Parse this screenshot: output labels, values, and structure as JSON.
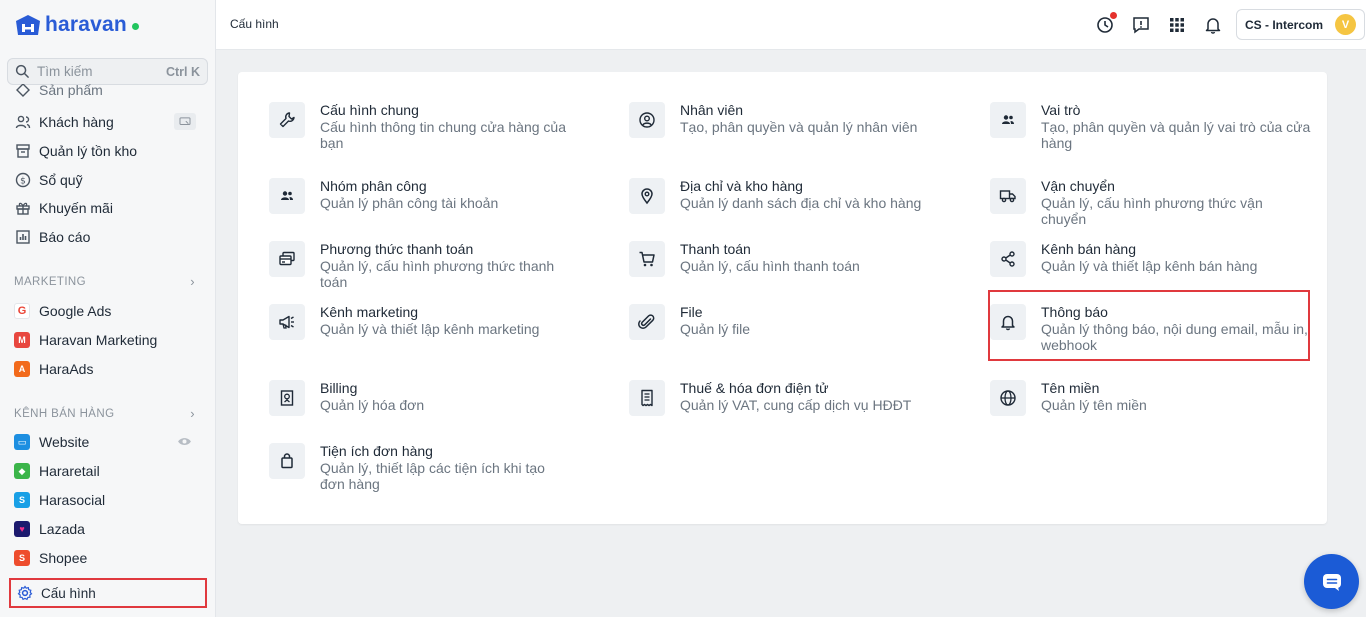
{
  "app": {
    "logo_text": "haravan"
  },
  "search": {
    "placeholder": "Tìm kiếm",
    "shortcut": "Ctrl K"
  },
  "sidebar": {
    "items": [
      {
        "label": "Sản phẩm"
      },
      {
        "label": "Khách hàng"
      },
      {
        "label": "Quản lý tồn kho"
      },
      {
        "label": "Sổ quỹ"
      },
      {
        "label": "Khuyến mãi"
      },
      {
        "label": "Báo cáo"
      }
    ],
    "marketing_section": "MARKETING",
    "marketing_items": [
      {
        "label": "Google Ads"
      },
      {
        "label": "Haravan Marketing"
      },
      {
        "label": "HaraAds"
      }
    ],
    "sales_section": "KÊNH BÁN HÀNG",
    "sales_items": [
      {
        "label": "Website"
      },
      {
        "label": "Hararetail"
      },
      {
        "label": "Harasocial"
      },
      {
        "label": "Lazada"
      },
      {
        "label": "Shopee"
      }
    ],
    "settings_label": "Cấu hình"
  },
  "header": {
    "breadcrumb": "Cấu hình",
    "store_name": "CS - Intercom",
    "avatar_initial": "V"
  },
  "settings": {
    "tiles": [
      {
        "title": "Cấu hình chung",
        "desc": "Cấu hình thông tin chung cửa hàng của bạn"
      },
      {
        "title": "Nhân viên",
        "desc": "Tạo, phân quyền và quản lý nhân viên"
      },
      {
        "title": "Vai trò",
        "desc": "Tạo, phân quyền và quản lý vai trò của cửa hàng"
      },
      {
        "title": "Nhóm phân công",
        "desc": "Quản lý phân công tài khoản"
      },
      {
        "title": "Địa chỉ và kho hàng",
        "desc": "Quản lý danh sách địa chỉ và kho hàng"
      },
      {
        "title": "Vận chuyển",
        "desc": "Quản lý, cấu hình phương thức vận chuyển"
      },
      {
        "title": "Phương thức thanh toán",
        "desc": "Quản lý, cấu hình phương thức thanh toán"
      },
      {
        "title": "Thanh toán",
        "desc": "Quản lý, cấu hình thanh toán"
      },
      {
        "title": "Kênh bán hàng",
        "desc": "Quản lý và thiết lập kênh bán hàng"
      },
      {
        "title": "Kênh marketing",
        "desc": "Quản lý và thiết lập kênh marketing"
      },
      {
        "title": "File",
        "desc": "Quản lý file"
      },
      {
        "title": "Thông báo",
        "desc": "Quản lý thông báo, nội dung email, mẫu in, webhook"
      },
      {
        "title": "Billing",
        "desc": "Quản lý hóa đơn"
      },
      {
        "title": "Thuế & hóa đơn điện tử",
        "desc": "Quản lý VAT, cung cấp dịch vụ HĐĐT"
      },
      {
        "title": "Tên miền",
        "desc": "Quản lý tên miền"
      },
      {
        "title": "Tiện ích đơn hàng",
        "desc": "Quản lý, thiết lập các tiện ích khi tạo đơn hàng"
      }
    ]
  },
  "colors": {
    "brand": "#2a5cd6",
    "highlight": "#e0393e",
    "chat": "#1b5bd6"
  }
}
